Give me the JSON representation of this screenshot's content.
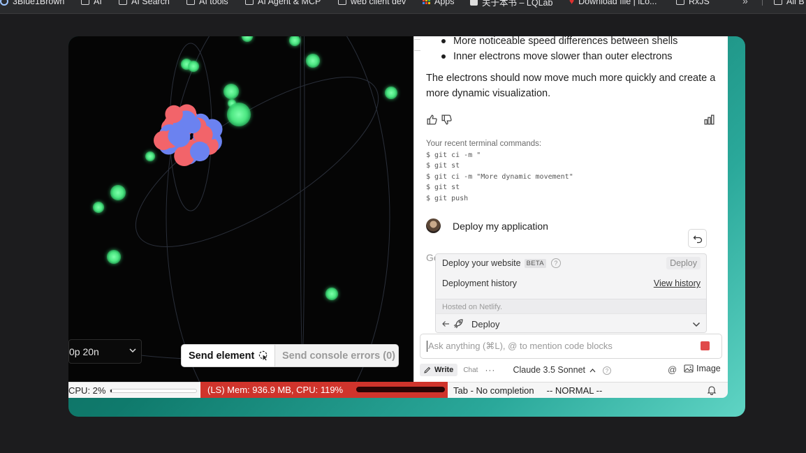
{
  "bookmarks": {
    "items": [
      {
        "label": "3Blue1Brown",
        "icon": "circle-icon"
      },
      {
        "label": "AI",
        "icon": "folder-icon"
      },
      {
        "label": "AI Search",
        "icon": "folder-icon"
      },
      {
        "label": "AI tools",
        "icon": "folder-icon"
      },
      {
        "label": "AI Agent & MCP",
        "icon": "folder-icon"
      },
      {
        "label": "web client dev",
        "icon": "folder-icon"
      },
      {
        "label": "Apps",
        "icon": "apps-grid-icon"
      },
      {
        "label": "关于本书 – LQLab",
        "icon": "page-icon"
      },
      {
        "label": "Download file | iLo...",
        "icon": "heart-icon"
      },
      {
        "label": "RxJS",
        "icon": "folder-icon"
      },
      {
        "label": "All B",
        "icon": "folder-icon"
      }
    ],
    "overflow": "»"
  },
  "canvas": {
    "process_select": "0p 20n",
    "send_element": "Send element",
    "send_console": "Send console errors (0)"
  },
  "chat": {
    "bullets": [
      "More noticeable speed differences between shells",
      "Inner electrons move slower than outer electrons"
    ],
    "paragraph": "The electrons should now move much more quickly and create a more dynamic visualization.",
    "terminal": {
      "header": "Your recent terminal commands:",
      "commands": [
        "$ git ci -m \"",
        "$ git st",
        "$ git ci -m \"More dynamic movement\"",
        "$ git st",
        "$ git push"
      ]
    },
    "user_message": "Deploy my application",
    "generating_stub": "Ge",
    "deploy_popup": {
      "title": "Deploy your website",
      "badge": "BETA",
      "help": "?",
      "deploy_label": "Deploy",
      "history_label": "Deployment history",
      "history_link": "View history",
      "hosted": "Hosted on Netlify.",
      "footer_action": "Deploy"
    },
    "input_placeholder": "Ask anything (⌘L), @ to mention code blocks",
    "toolbar": {
      "write": "Write",
      "chat": "Chat",
      "more": "···",
      "model": "Claude 3.5 Sonnet",
      "help": "?",
      "at": "@",
      "image": "Image"
    }
  },
  "status": {
    "cpu": "CPU: 2%",
    "cpu_fraction": 0.02,
    "ls": "(LS) Mem: 936.9 MB, CPU: 119%",
    "mem_fraction": 1.0,
    "completion": "Tab - No completion",
    "mode": "-- NORMAL --"
  },
  "colors": {
    "accent_teal": "#0f7a6c",
    "electron": "#5cf08c",
    "proton": "#f2646a",
    "neutron": "#6b82f0",
    "status_red": "#d0342c"
  }
}
